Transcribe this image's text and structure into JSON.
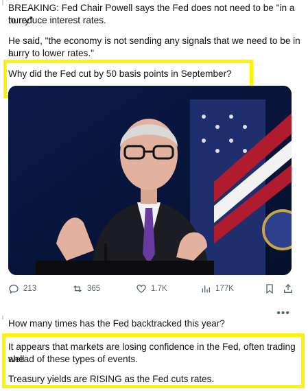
{
  "tweet1": {
    "line1": "BREAKING: Fed Chair Powell says the Fed does not need to be \"in a hurry\"",
    "line2": "to reduce interest rates.",
    "line3": "He said, \"the economy is not sending any signals that we need to be in a",
    "line4": "hurry to lower rates.\"",
    "line5": "Why did the Fed cut by 50 basis points in September?"
  },
  "actions": {
    "replies": "213",
    "reposts": "365",
    "likes": "1.7K",
    "views": "177K"
  },
  "tweet2": {
    "line1": "How many times has the Fed backtracked this year?",
    "line2": "It appears that markets are losing confidence in the Fed, often trading well",
    "line3": "ahead of these types of events.",
    "line4": "Treasury yields are RISING as the Fed cuts rates."
  },
  "colors": {
    "highlight": "#fff200",
    "muted": "#536471"
  }
}
